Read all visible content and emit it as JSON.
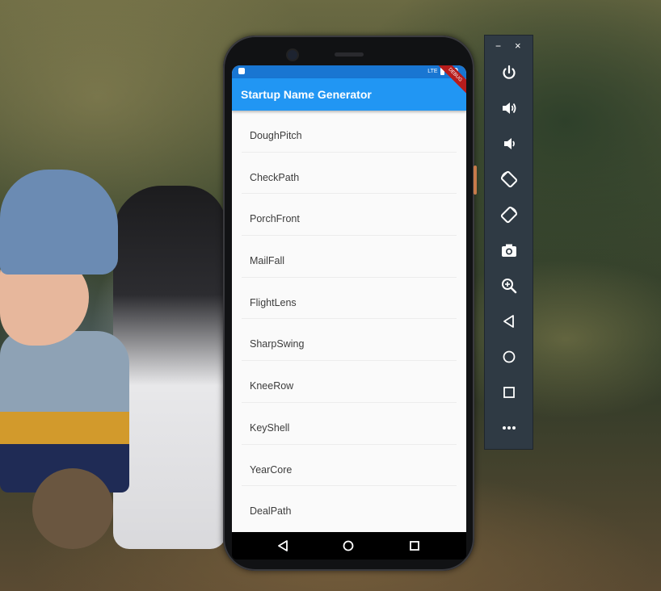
{
  "app": {
    "title": "Startup Name Generator",
    "status_time": "4:0",
    "status_signal": "LTE",
    "debug_label": "DEBUG",
    "accent_color": "#2196f3",
    "status_bar_color": "#1976d2"
  },
  "list": {
    "items": [
      {
        "label": "DoughPitch"
      },
      {
        "label": "CheckPath"
      },
      {
        "label": "PorchFront"
      },
      {
        "label": "MailFall"
      },
      {
        "label": "FlightLens"
      },
      {
        "label": "SharpSwing"
      },
      {
        "label": "KneeRow"
      },
      {
        "label": "KeyShell"
      },
      {
        "label": "YearCore"
      },
      {
        "label": "DealPath"
      }
    ]
  },
  "navigation": {
    "buttons": [
      {
        "icon": "back-triangle-icon"
      },
      {
        "icon": "home-circle-icon"
      },
      {
        "icon": "recent-square-icon"
      }
    ]
  },
  "emulator_toolbar": {
    "minimize_label": "−",
    "close_label": "×",
    "buttons": [
      {
        "icon": "power-icon"
      },
      {
        "icon": "volume-up-icon"
      },
      {
        "icon": "volume-down-icon"
      },
      {
        "icon": "rotate-left-icon"
      },
      {
        "icon": "rotate-right-icon"
      },
      {
        "icon": "camera-icon"
      },
      {
        "icon": "zoom-icon"
      },
      {
        "icon": "back-icon"
      },
      {
        "icon": "home-icon"
      },
      {
        "icon": "overview-icon"
      },
      {
        "icon": "more-icon"
      }
    ]
  }
}
